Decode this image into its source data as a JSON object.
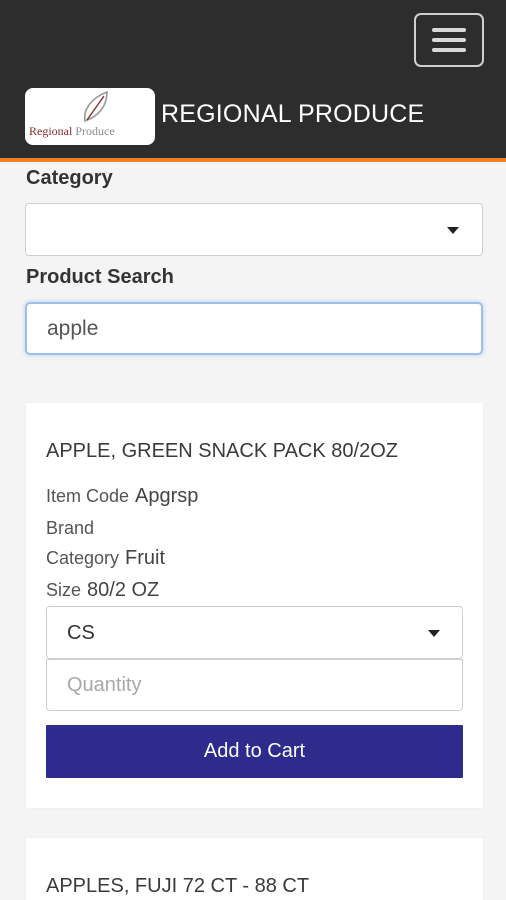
{
  "header": {
    "title": "REGIONAL PRODUCE",
    "logo": {
      "text_part1": "Regional",
      "text_part2": "Produce"
    },
    "menu_icon": "hamburger-menu-icon",
    "accent_color": "#f07f1e"
  },
  "filters": {
    "category_label": "Category",
    "category_value": "",
    "search_label": "Product Search",
    "search_value": "apple"
  },
  "products": [
    {
      "name": "APPLE, GREEN SNACK PACK 80/2OZ",
      "item_code_label": "Item Code",
      "item_code": "Apgrsp",
      "brand_label": "Brand",
      "brand": "",
      "category_label": "Category",
      "category": "Fruit",
      "size_label": "Size",
      "size": "80/2 OZ",
      "unit": "CS",
      "quantity_placeholder": "Quantity",
      "add_label": "Add to Cart"
    },
    {
      "name": "APPLES, FUJI 72 CT - 88 CT"
    }
  ],
  "colors": {
    "button": "#2d2b8c",
    "navbar": "#2d2d2d",
    "focus_border": "#9dc0e8"
  }
}
